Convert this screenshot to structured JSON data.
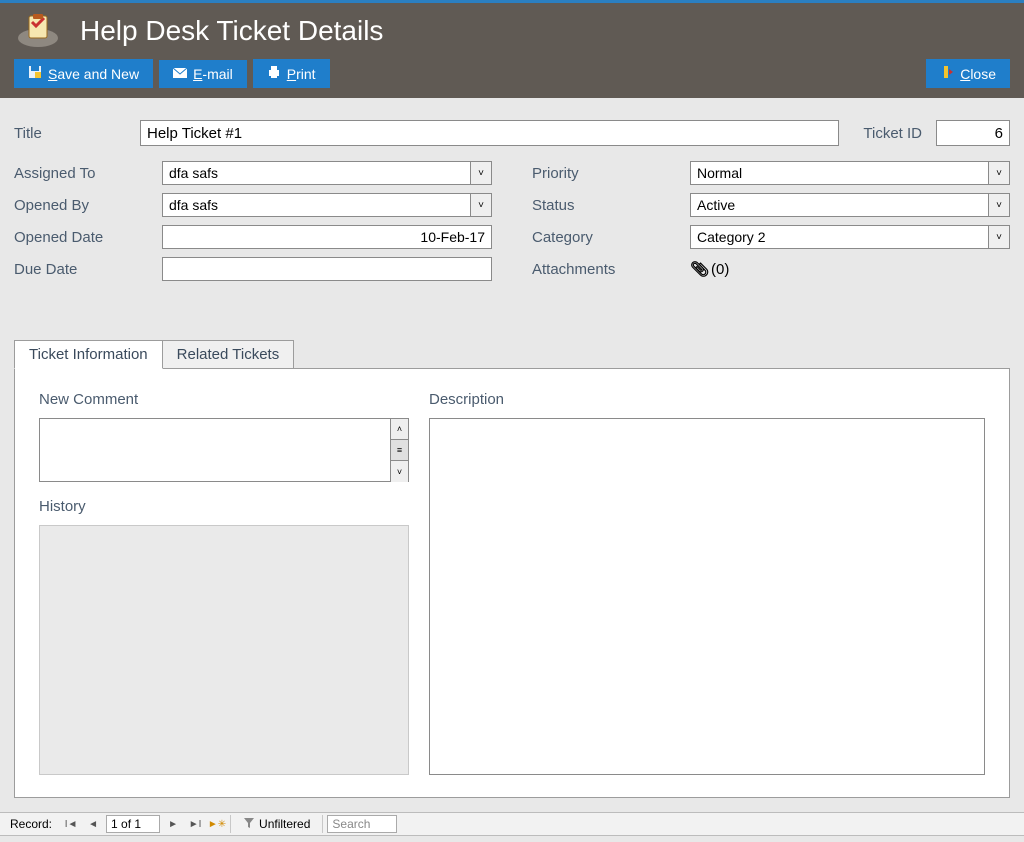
{
  "header": {
    "title": "Help Desk Ticket Details",
    "save_and_new": "Save and New",
    "save_and_new_key": "S",
    "email": "E-mail",
    "email_key": "E",
    "print": "Print",
    "print_key": "P",
    "close": "Close",
    "close_key": "C"
  },
  "form": {
    "title_label": "Title",
    "title_value": "Help Ticket #1",
    "ticket_id_label": "Ticket ID",
    "ticket_id_value": "6",
    "assigned_to_label": "Assigned To",
    "assigned_to_value": "dfa safs",
    "opened_by_label": "Opened By",
    "opened_by_value": "dfa safs",
    "opened_date_label": "Opened Date",
    "opened_date_value": "10-Feb-17",
    "due_date_label": "Due Date",
    "due_date_value": "",
    "priority_label": "Priority",
    "priority_value": "Normal",
    "status_label": "Status",
    "status_value": "Active",
    "category_label": "Category",
    "category_value": "Category 2",
    "attachments_label": "Attachments",
    "attachments_count": "(0)"
  },
  "tabs": {
    "ticket_info": "Ticket Information",
    "related": "Related Tickets",
    "new_comment_label": "New Comment",
    "history_label": "History",
    "description_label": "Description"
  },
  "nav": {
    "record_label": "Record:",
    "position": "1 of 1",
    "filter_label": "Unfiltered",
    "search_placeholder": "Search"
  }
}
